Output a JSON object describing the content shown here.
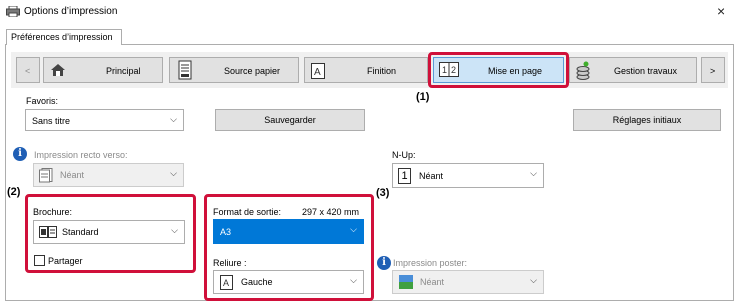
{
  "window": {
    "title": "Options d’impression",
    "close_glyph": "×"
  },
  "tabs": [
    {
      "label": "Préférences d’impression"
    }
  ],
  "nav": {
    "prev": "<",
    "next": ">",
    "items": [
      {
        "label": "Principal",
        "icon": "home-icon"
      },
      {
        "label": "Source papier",
        "icon": "printer-tray-icon"
      },
      {
        "label": "Finition",
        "icon": "letter-a-icon"
      },
      {
        "label": "Mise en page",
        "icon": "page-layout-icon",
        "active": true
      },
      {
        "label": "Gestion travaux",
        "icon": "coins-stack-icon"
      }
    ]
  },
  "favorites": {
    "label": "Favoris:",
    "value": "Sans titre",
    "save_button": "Sauvegarder",
    "reset_button": "Réglages initiaux"
  },
  "duplex": {
    "label": "Impression recto verso:",
    "value": "Néant"
  },
  "nup": {
    "label": "N-Up:",
    "value": "Néant",
    "icon_text": "1"
  },
  "booklet": {
    "label": "Brochure:",
    "value": "Standard",
    "split_label": "Partager"
  },
  "output_size": {
    "label": "Format de sortie:",
    "dimensions": "297 x 420 mm",
    "value": "A3"
  },
  "binding": {
    "label": "Reliure :",
    "value": "Gauche"
  },
  "poster": {
    "label": "Impression poster:",
    "value": "Néant"
  },
  "callouts": {
    "one": "(1)",
    "two": "(2)",
    "three": "(3)"
  },
  "colors": {
    "accent_red": "#d0103a",
    "selection_blue": "#0078d7",
    "info_blue": "#1f5fb5"
  }
}
